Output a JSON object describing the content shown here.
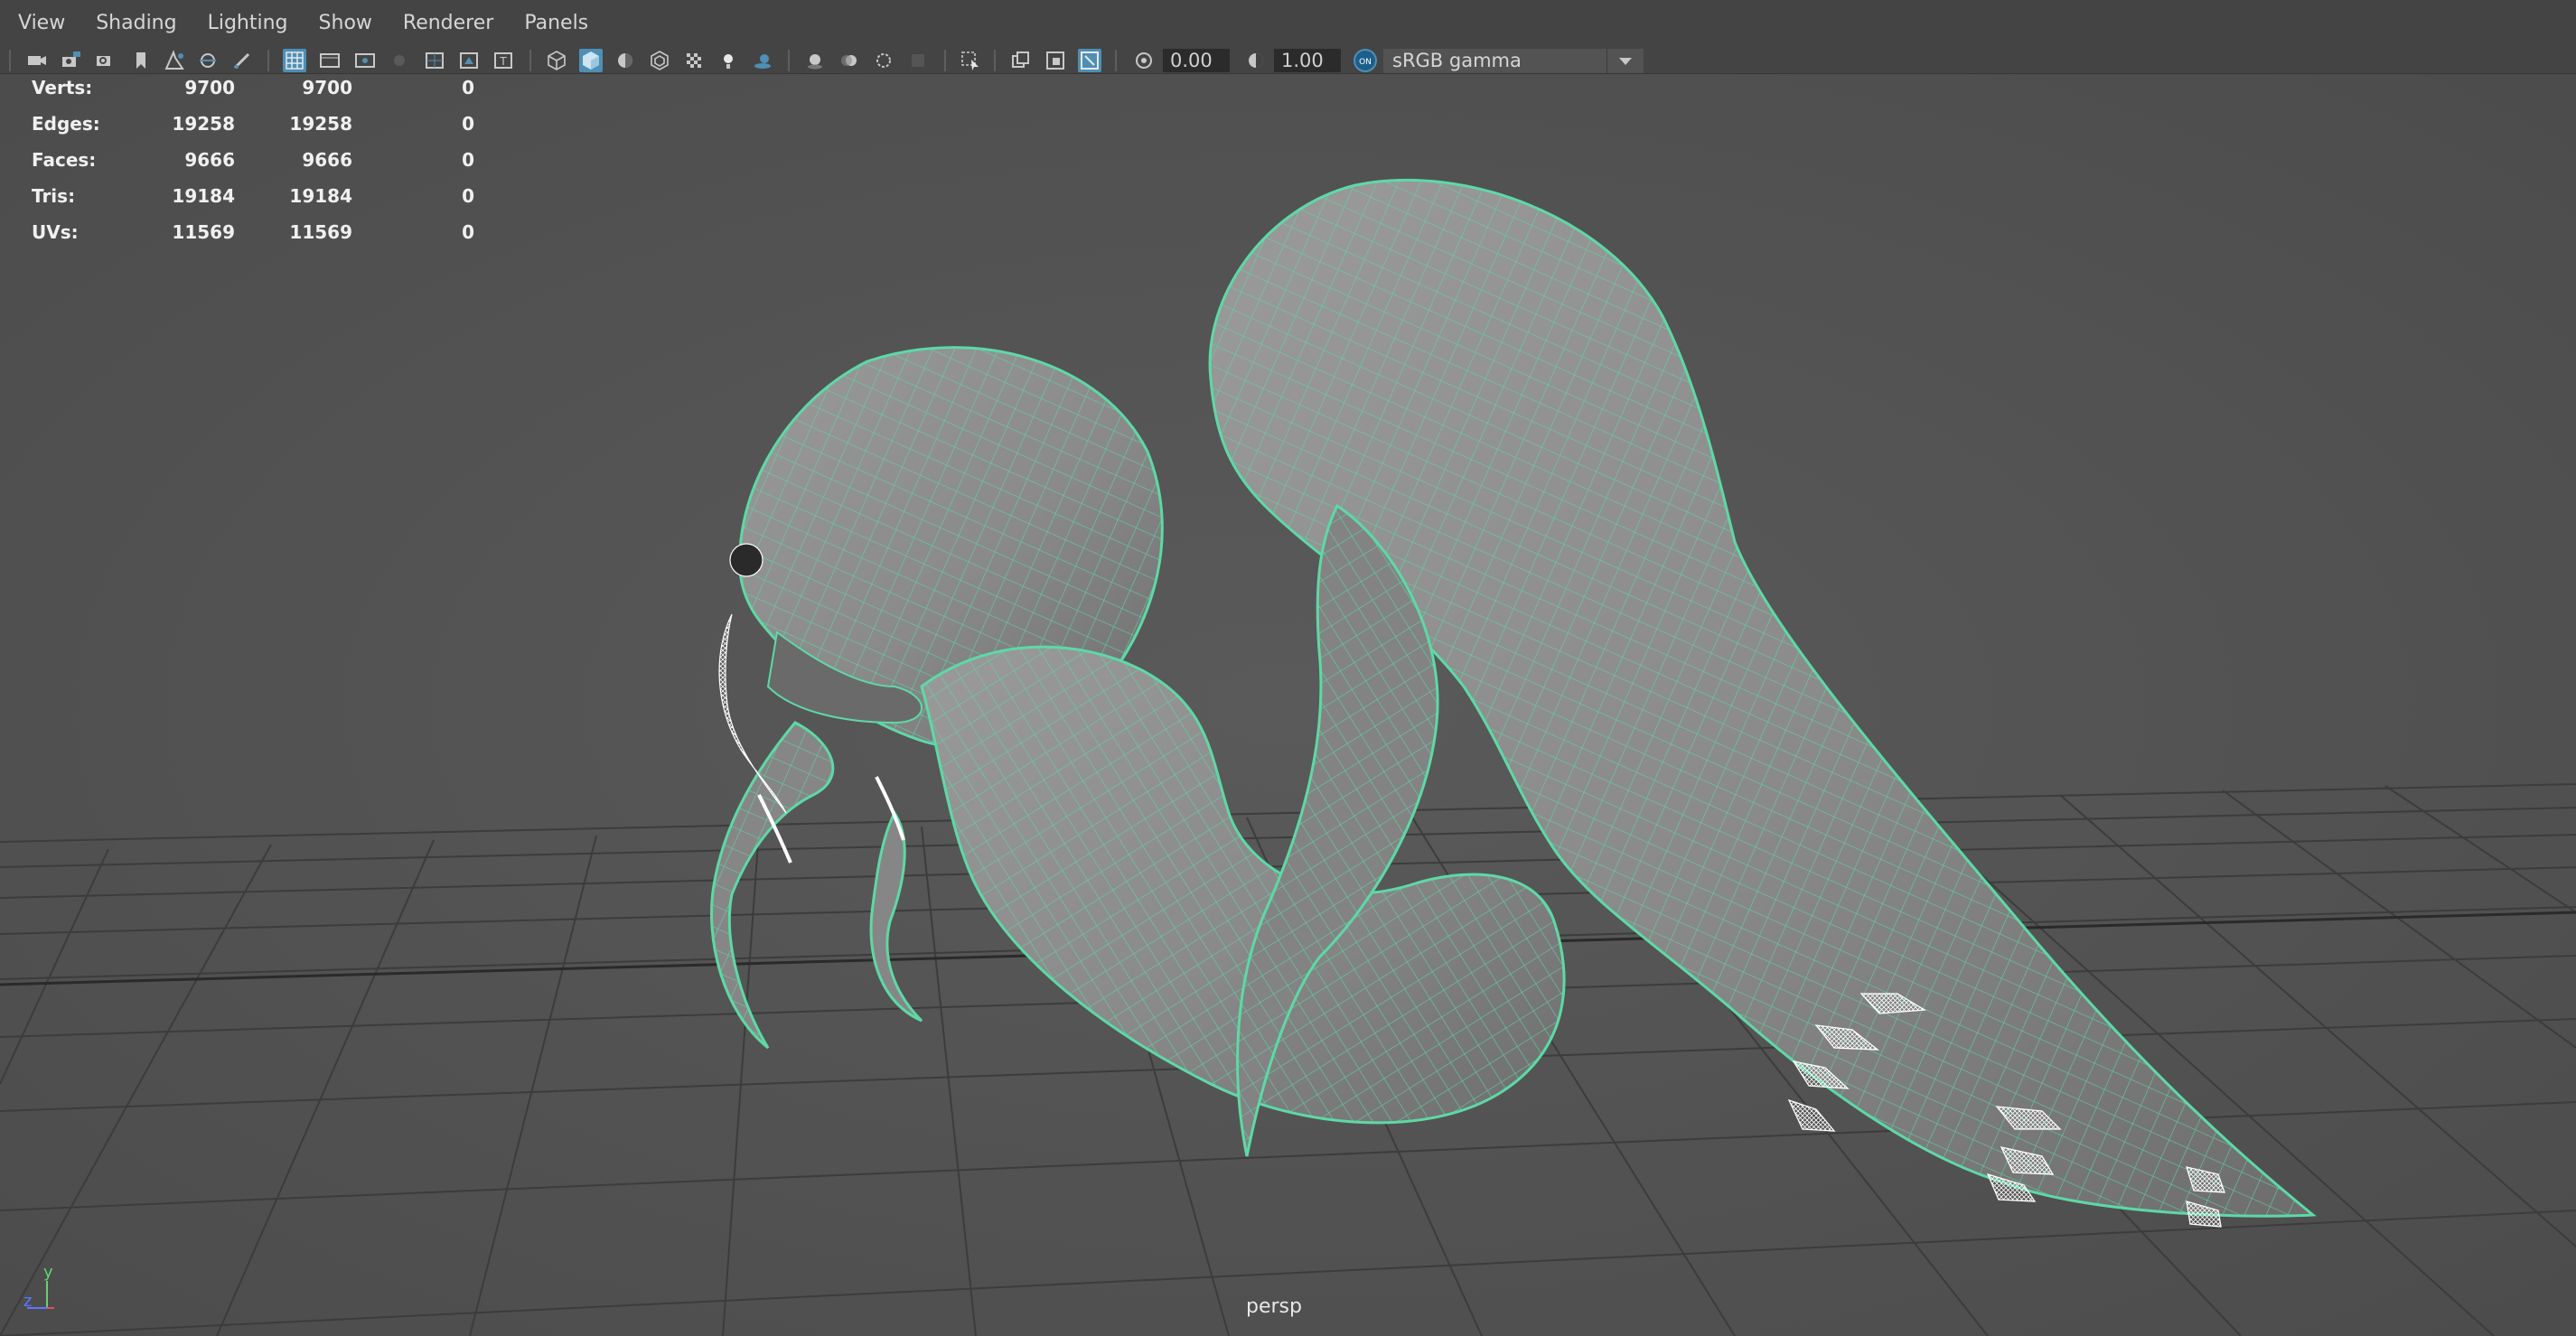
{
  "menu": [
    "View",
    "Shading",
    "Lighting",
    "Show",
    "Renderer",
    "Panels"
  ],
  "toolbar": {
    "exposure": "0.00",
    "gamma": "1.00",
    "color_management_badge": "ON",
    "colorspace": "sRGB gamma"
  },
  "hud": {
    "rows": [
      {
        "label": "Verts:",
        "v1": "9700",
        "v2": "9700",
        "v3": "0"
      },
      {
        "label": "Edges:",
        "v1": "19258",
        "v2": "19258",
        "v3": "0"
      },
      {
        "label": "Faces:",
        "v1": "9666",
        "v2": "9666",
        "v3": "0"
      },
      {
        "label": "Tris:",
        "v1": "19184",
        "v2": "19184",
        "v3": "0"
      },
      {
        "label": "UVs:",
        "v1": "11569",
        "v2": "11569",
        "v3": "0"
      }
    ]
  },
  "camera_label": "persp",
  "axis": {
    "y": "y",
    "z": "z"
  },
  "colors": {
    "wireframe": "#5dd9a6",
    "mesh": "#8e8e8e",
    "grid": "#3e3e3e",
    "active_button": "#4e8fb5"
  }
}
